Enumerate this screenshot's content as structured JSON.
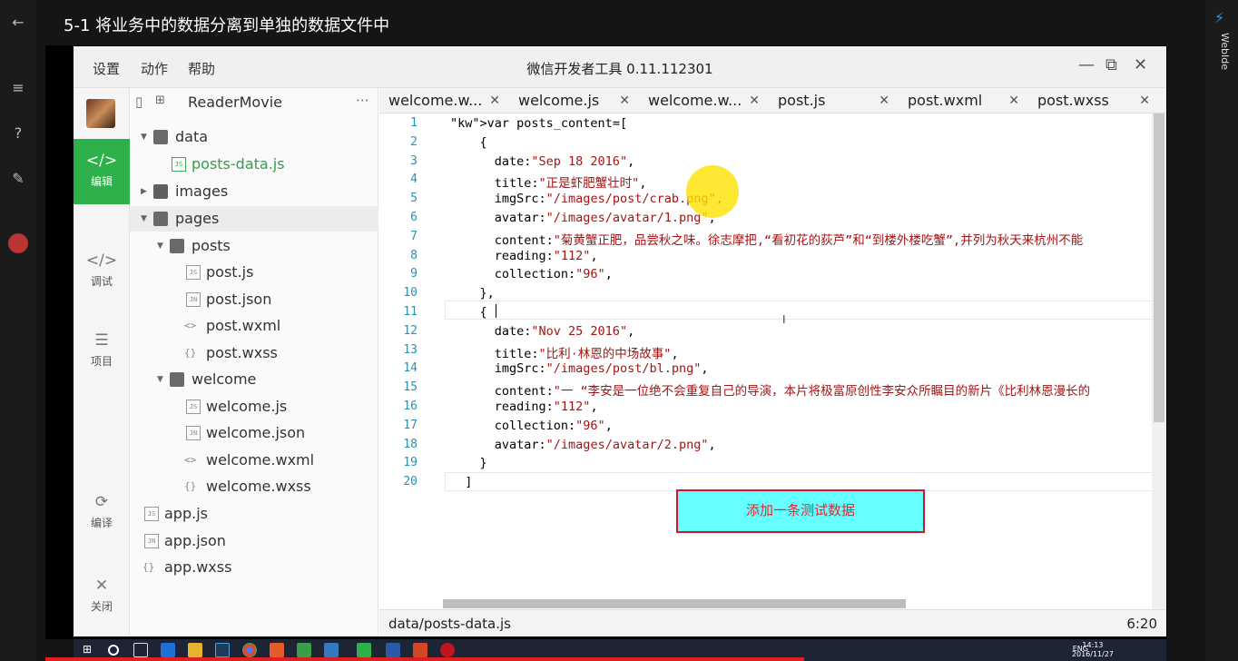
{
  "player": {
    "lesson_title": "5-1 将业务中的数据分离到单独的数据文件中",
    "side_label": "WebIde"
  },
  "app": {
    "menu": [
      "设置",
      "动作",
      "帮助"
    ],
    "title": "微信开发者工具 0.11.112301"
  },
  "toolbar": {
    "items": [
      {
        "label": "编辑",
        "icon": "code-icon",
        "active": true
      },
      {
        "label": "调试",
        "icon": "debug-icon",
        "active": false
      },
      {
        "label": "项目",
        "icon": "menu-icon",
        "active": false
      },
      {
        "label": "编译",
        "icon": "compile-icon",
        "active": false
      },
      {
        "label": "关闭",
        "icon": "close-icon",
        "active": false
      }
    ]
  },
  "tree": {
    "project_name": "ReaderMovie",
    "nodes": [
      {
        "label": "data",
        "type": "folder",
        "badge": ""
      },
      {
        "label": "posts-data.js",
        "type": "js",
        "badge": "JS"
      },
      {
        "label": "images",
        "type": "folder",
        "badge": ""
      },
      {
        "label": "pages",
        "type": "folder",
        "badge": ""
      },
      {
        "label": "posts",
        "type": "folder",
        "badge": ""
      },
      {
        "label": "post.js",
        "type": "js",
        "badge": "JS"
      },
      {
        "label": "post.json",
        "type": "json",
        "badge": "JN"
      },
      {
        "label": "post.wxml",
        "type": "wxml",
        "badge": "<>"
      },
      {
        "label": "post.wxss",
        "type": "wxss",
        "badge": "{}"
      },
      {
        "label": "welcome",
        "type": "folder",
        "badge": ""
      },
      {
        "label": "welcome.js",
        "type": "js",
        "badge": "JS"
      },
      {
        "label": "welcome.json",
        "type": "json",
        "badge": "JN"
      },
      {
        "label": "welcome.wxml",
        "type": "wxml",
        "badge": "<>"
      },
      {
        "label": "welcome.wxss",
        "type": "wxss",
        "badge": "{}"
      },
      {
        "label": "app.js",
        "type": "js",
        "badge": "JS"
      },
      {
        "label": "app.json",
        "type": "json",
        "badge": "JN"
      },
      {
        "label": "app.wxss",
        "type": "wxss",
        "badge": "{}"
      }
    ]
  },
  "tabs": [
    {
      "label": "welcome.w..."
    },
    {
      "label": "welcome.js"
    },
    {
      "label": "welcome.w..."
    },
    {
      "label": "post.js"
    },
    {
      "label": "post.wxml"
    },
    {
      "label": "post.wxss"
    }
  ],
  "editor": {
    "line_numbers": [
      "1",
      "2",
      "3",
      "4",
      "5",
      "6",
      "7",
      "8",
      "9",
      "10",
      "11",
      "12",
      "13",
      "14",
      "15",
      "16",
      "17",
      "18",
      "19",
      "20"
    ],
    "lines": [
      "var posts_content=[",
      "    {",
      "      date:\"Sep 18 2016\",",
      "      title:\"正是虾肥蟹壮时\",",
      "      imgSrc:\"/images/post/crab.png\",",
      "      avatar:\"/images/avatar/1.png\",",
      "      content:\"菊黄蟹正肥，品尝秋之味。徐志摩把,“看初花的荻芦”和“到楼外楼吃蟹”,并列为秋天来杭州不能",
      "      reading:\"112\",",
      "      collection:\"96\",",
      "    },",
      "    {",
      "      date:\"Nov 25 2016\",",
      "      title:\"比利·林恩的中场故事\",",
      "      imgSrc:\"/images/post/bl.png\",",
      "      content:\"一 “李安是一位绝不会重复自己的导演，本片将极富原创性李安众所瞩目的新片《比利林恩漫长的",
      "      reading:\"112\",",
      "      collection:\"96\",",
      "      avatar:\"/images/avatar/2.png\",",
      "    }",
      "  ]"
    ],
    "annotation_button": "添加一条测试数据"
  },
  "status": {
    "path": "data/posts-data.js",
    "position": "6:20"
  },
  "taskbar": {
    "lang": "ENG",
    "clock_time": "14:13",
    "clock_date": "2016/11/27"
  },
  "colors": {
    "accent_green": "#2db14a",
    "annotation_fill": "#66ffff",
    "annotation_border": "#d0192b"
  }
}
